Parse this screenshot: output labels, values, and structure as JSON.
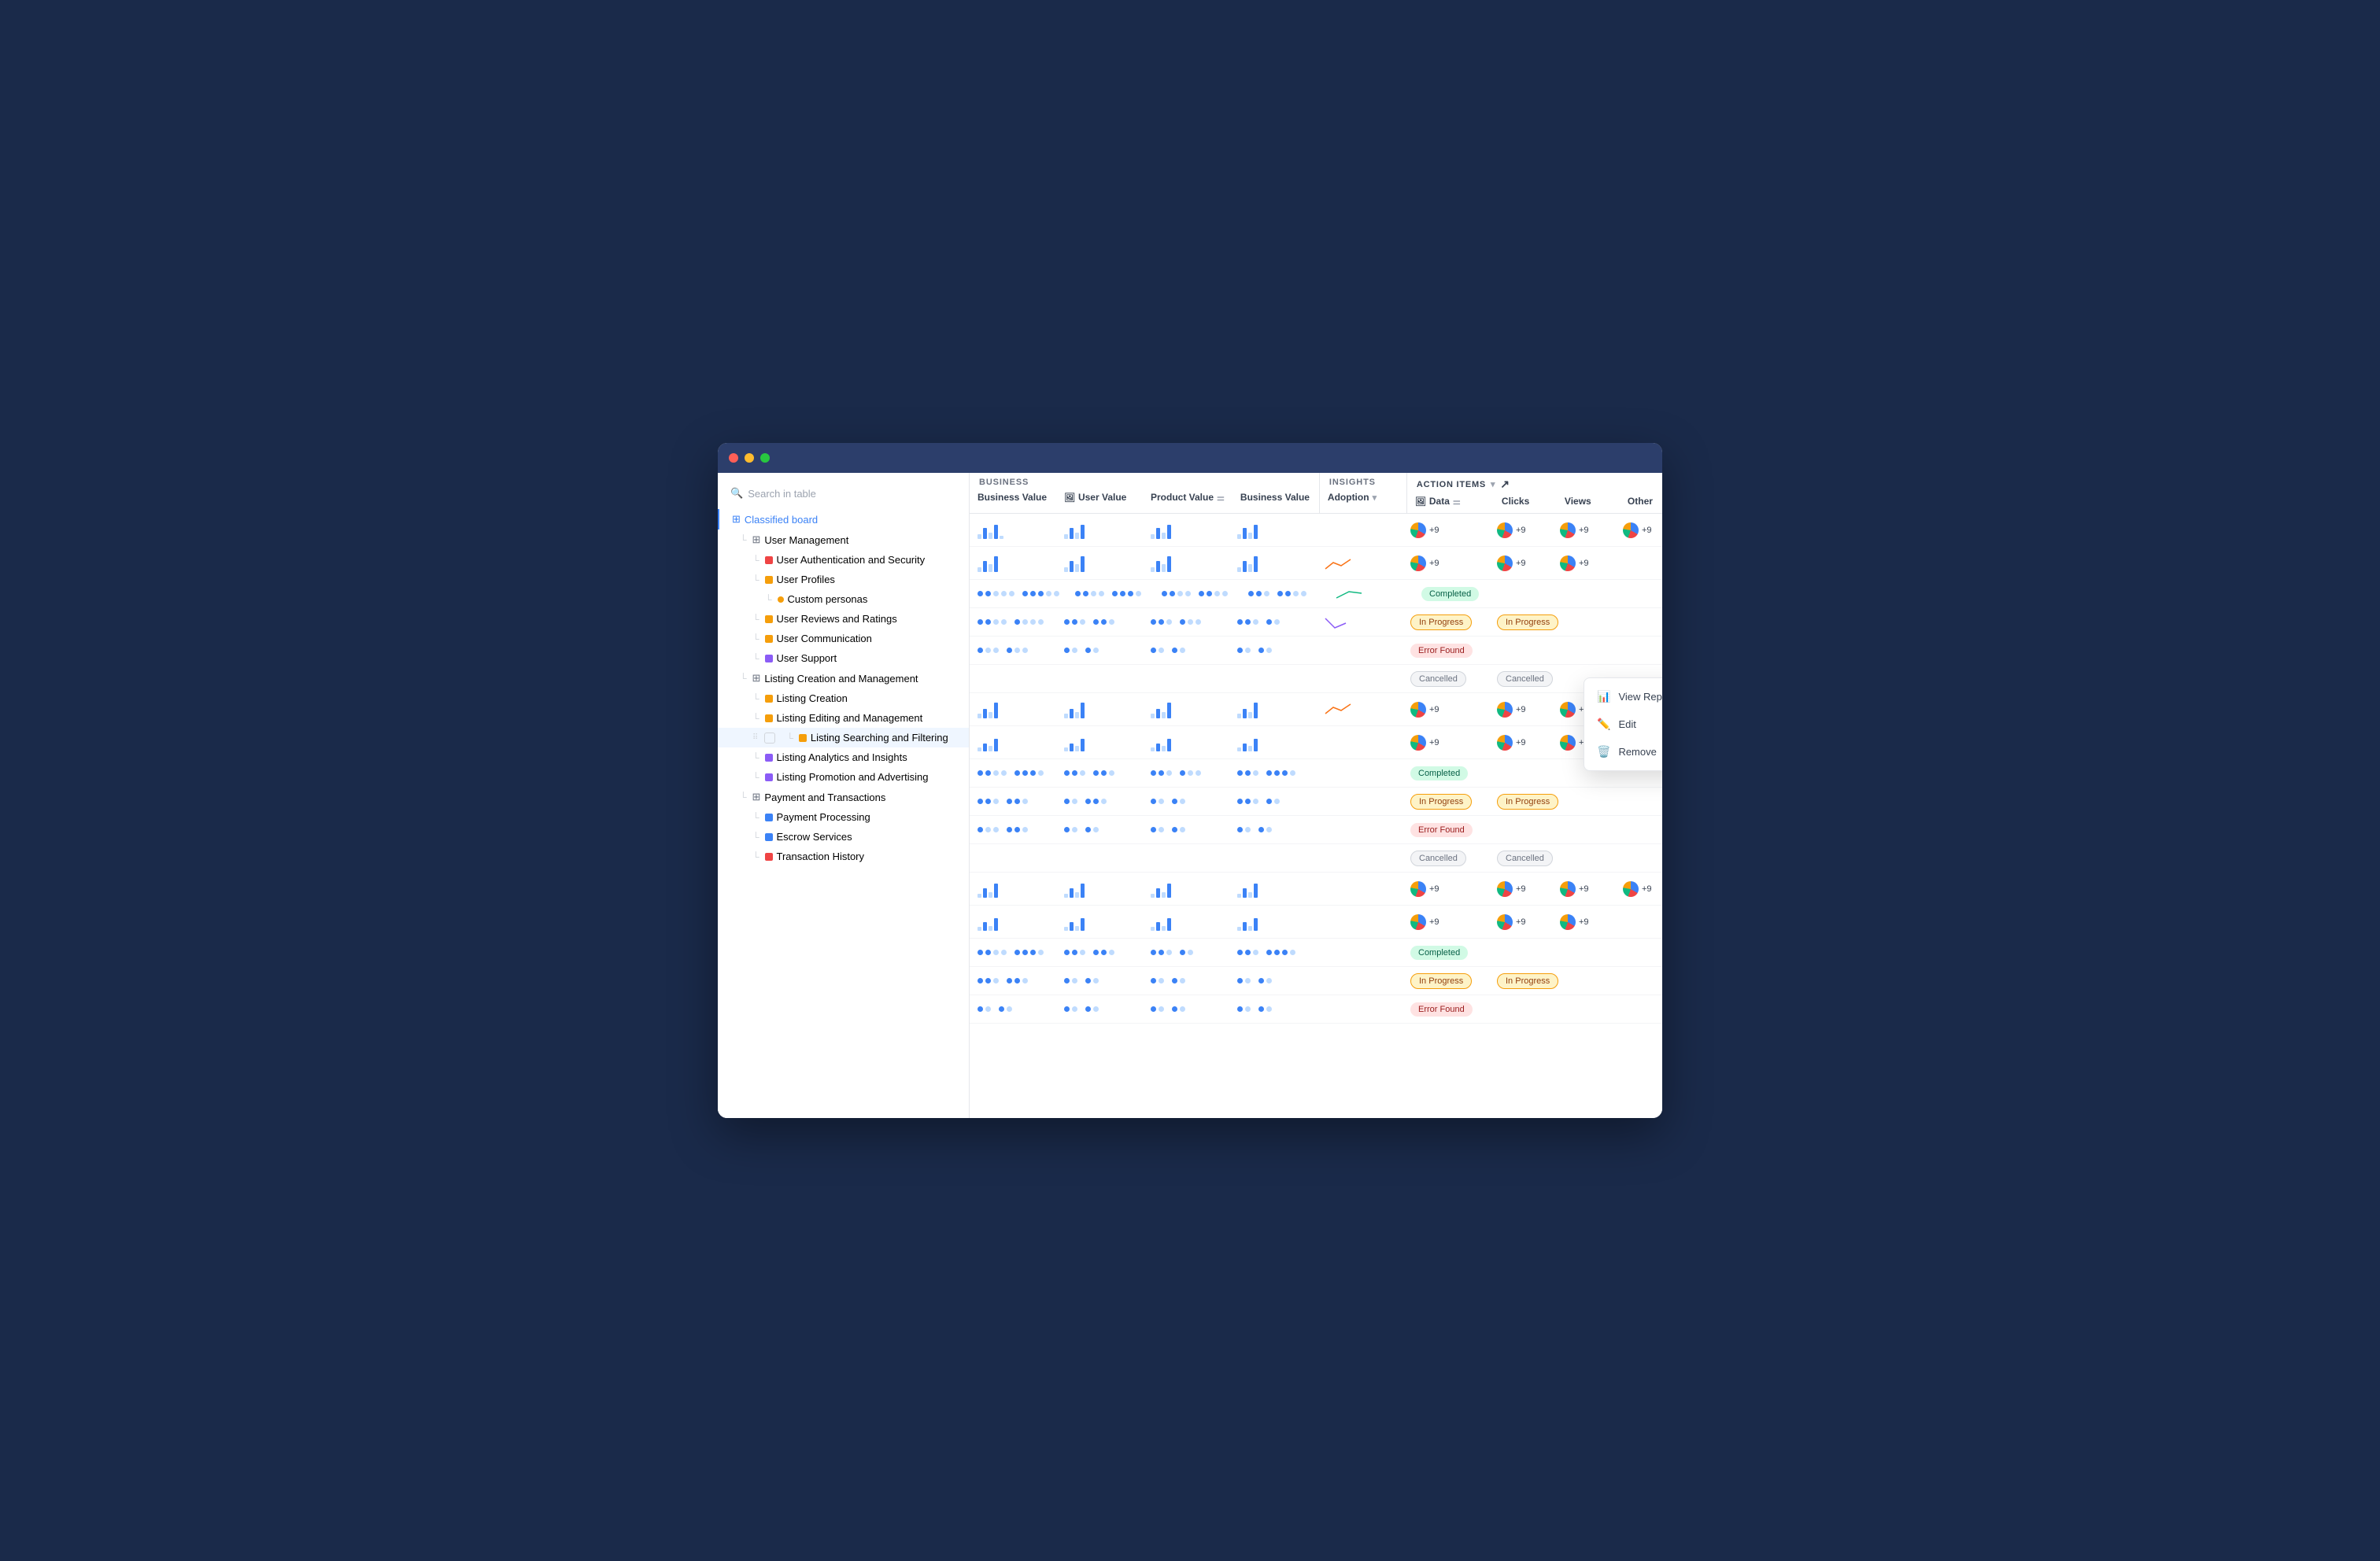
{
  "window": {
    "dots": [
      "red",
      "yellow",
      "green"
    ]
  },
  "search": {
    "placeholder": "Search in table"
  },
  "sections": {
    "business": {
      "label": "BUSINESS",
      "columns": [
        "Business Value",
        "User Value",
        "Product Value",
        "Business Value"
      ]
    },
    "insights": {
      "label": "INSIGHTS",
      "columns": [
        "Adoption"
      ]
    },
    "actionItems": {
      "label": "ACTION ITEMS",
      "columns": [
        "Data",
        "Clicks",
        "Views",
        "Other"
      ]
    }
  },
  "tree": [
    {
      "id": "classified-board",
      "label": "Classified board",
      "type": "board",
      "indent": 0
    },
    {
      "id": "user-management",
      "label": "User Management",
      "type": "grid",
      "indent": 1
    },
    {
      "id": "user-auth",
      "label": "User Authentication and Security",
      "type": "red",
      "indent": 2
    },
    {
      "id": "user-profiles",
      "label": "User Profiles",
      "type": "yellow",
      "indent": 2
    },
    {
      "id": "custom-personas",
      "label": "Custom personas",
      "type": "dot-yellow",
      "indent": 3
    },
    {
      "id": "user-reviews",
      "label": "User Reviews and Ratings",
      "type": "yellow",
      "indent": 2
    },
    {
      "id": "user-comm",
      "label": "User Communication",
      "type": "yellow",
      "indent": 2
    },
    {
      "id": "user-support",
      "label": "User Support",
      "type": "purple",
      "indent": 2
    },
    {
      "id": "listing-creation-mgmt",
      "label": "Listing Creation and Management",
      "type": "grid",
      "indent": 1
    },
    {
      "id": "listing-creation",
      "label": "Listing Creation",
      "type": "yellow",
      "indent": 2
    },
    {
      "id": "listing-editing",
      "label": "Listing Editing and Management",
      "type": "yellow",
      "indent": 2
    },
    {
      "id": "listing-searching",
      "label": "Listing Searching and Filtering",
      "type": "yellow",
      "indent": 2,
      "highlight": true
    },
    {
      "id": "listing-analytics",
      "label": "Listing Analytics and Insights",
      "type": "purple",
      "indent": 2
    },
    {
      "id": "listing-promotion",
      "label": "Listing Promotion and Advertising",
      "type": "purple",
      "indent": 2
    },
    {
      "id": "payment-transactions",
      "label": "Payment and Transactions",
      "type": "grid",
      "indent": 1
    },
    {
      "id": "payment-processing",
      "label": "Payment Processing",
      "type": "blue",
      "indent": 2
    },
    {
      "id": "escrow-services",
      "label": "Escrow Services",
      "type": "blue",
      "indent": 2
    },
    {
      "id": "transaction-history",
      "label": "Transaction History",
      "type": "red",
      "indent": 2
    }
  ],
  "rows": [
    {
      "type": "group",
      "hasData": true,
      "adoption": "none",
      "badges": [],
      "donuts": [
        4,
        4,
        4,
        4
      ]
    },
    {
      "type": "group",
      "hasData": true,
      "adoption": "trend-up",
      "badges": [],
      "donuts": [
        4,
        4,
        4,
        0
      ]
    },
    {
      "type": "leaf",
      "hasData": false,
      "adoption": "none",
      "badges": [
        "Completed",
        ""
      ],
      "donuts": []
    },
    {
      "type": "leaf",
      "hasData": false,
      "adoption": "trend-down-purple",
      "badges": [
        "In Progress",
        "In Progress"
      ],
      "donuts": []
    },
    {
      "type": "leaf",
      "hasData": false,
      "adoption": "none",
      "badges": [
        "Error Found",
        ""
      ],
      "donuts": []
    },
    {
      "type": "leaf",
      "hasData": false,
      "adoption": "none",
      "badges": [
        "Cancelled",
        "Cancelled"
      ],
      "donuts": []
    },
    {
      "type": "group",
      "hasData": true,
      "adoption": "trend-up-orange",
      "badges": [],
      "donuts": [
        4,
        4,
        4,
        4
      ]
    },
    {
      "type": "group",
      "hasData": true,
      "adoption": "none",
      "badges": [],
      "donuts": [
        4,
        4,
        4,
        0
      ]
    },
    {
      "type": "leaf",
      "hasData": false,
      "adoption": "none",
      "badges": [
        "Completed",
        ""
      ],
      "donuts": []
    },
    {
      "type": "leaf",
      "hasData": false,
      "adoption": "none",
      "badges": [
        "In Progress",
        "In Progress"
      ],
      "donuts": []
    },
    {
      "type": "leaf",
      "hasData": false,
      "adoption": "none",
      "badges": [
        "Error Found",
        ""
      ],
      "donuts": []
    },
    {
      "type": "leaf",
      "hasData": false,
      "adoption": "none",
      "badges": [
        "Cancelled",
        "Cancelled"
      ],
      "donuts": []
    },
    {
      "type": "group",
      "hasData": true,
      "adoption": "none",
      "badges": [],
      "donuts": [
        4,
        4,
        4,
        4
      ]
    },
    {
      "type": "group",
      "hasData": true,
      "adoption": "none",
      "badges": [],
      "donuts": [
        4,
        4,
        4,
        0
      ]
    },
    {
      "type": "leaf",
      "hasData": false,
      "adoption": "none",
      "badges": [
        "Completed",
        ""
      ],
      "donuts": []
    },
    {
      "type": "leaf",
      "hasData": false,
      "adoption": "none",
      "badges": [
        "In Progress",
        "In Progress"
      ],
      "donuts": []
    },
    {
      "type": "leaf",
      "hasData": false,
      "adoption": "none",
      "badges": [
        "Error Found",
        ""
      ],
      "donuts": []
    }
  ],
  "contextMenu": {
    "items": [
      {
        "id": "view-report",
        "icon": "📊",
        "label": "View Report"
      },
      {
        "id": "edit",
        "icon": "✏️",
        "label": "Edit"
      },
      {
        "id": "remove",
        "icon": "🗑️",
        "label": "Remove"
      }
    ]
  }
}
